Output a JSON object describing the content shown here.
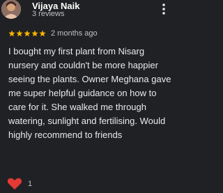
{
  "reviewer": {
    "name": "Vijaya Naik",
    "review_count": "3 reviews",
    "avatar_icon": "user-avatar"
  },
  "rating": {
    "stars": 5,
    "star_color": "#f4b400",
    "time": "2 months ago"
  },
  "review": {
    "text": "I bought my first plant from Nisarg nursery and couldn't be more happier seeing the plants. Owner Meghana gave me super helpful guidance on how to care for it. She walked me through watering, sunlight and fertilising. Would highly recommend to friends"
  },
  "reaction": {
    "icon": "heart-icon",
    "color": "#e53935",
    "count": "1"
  },
  "menu_icon": "more-vert-icon"
}
